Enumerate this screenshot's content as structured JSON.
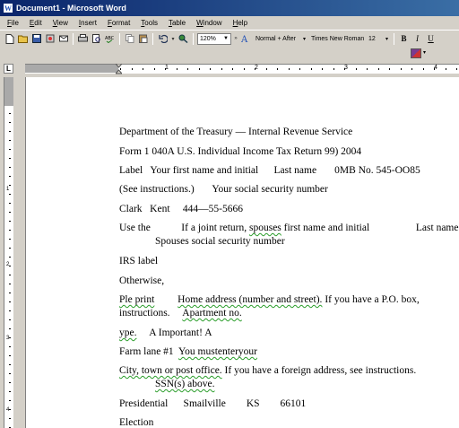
{
  "window": {
    "title": "Document1 - Microsoft Word"
  },
  "menu": [
    "File",
    "Edit",
    "View",
    "Insert",
    "Format",
    "Tools",
    "Table",
    "Window",
    "Help"
  ],
  "toolbar": {
    "zoom": "120%",
    "style": "Normal + After",
    "font": "Times New Roman",
    "size": "12",
    "bold": "B",
    "italic": "I",
    "underline": "U",
    "ruler_corner": "L"
  },
  "ruler": {
    "numbers": [
      "1",
      "2",
      "3",
      "4"
    ]
  },
  "vruler": {
    "numbers": [
      "1",
      "2",
      "3",
      "4"
    ]
  },
  "document": {
    "l1": "Department of the Treasury — Internal Revenue Service",
    "l2": "Form 1 040A U.S. Individual Income Tax Return 99) 2004",
    "l3a": "Label   Your first name and initial      Last name       0MB No. 545-OO85",
    "l4a": "(See instructions.)       Your social security number",
    "l5": "Clark   Kent     444—55-5666",
    "l6a": "Use the            If a joint return, ",
    "l6b": "spouses",
    "l6c": " first name and initial                  Last name",
    "l7": "Spouses social security number",
    "l8": "IRS label",
    "l9": "Otherwise,",
    "l10a": "Ple print",
    "l10b": "         ",
    "l10c": "Home address (number and street).",
    "l10d": " If you have a P.O. box,",
    "l11a": "instructions.",
    "l11b": "     ",
    "l11c": "Apartment no.",
    "l12a": "ype.",
    "l12b": "     A Important! A",
    "l13a": "Farm lane #1  ",
    "l13b": "You mustenteryour",
    "l14a": "City, town or post office.",
    "l14b": " If you have a foreign address, see instructions.",
    "l15": "SSN(s) above.",
    "l16": "Presidential      Smailville        KS        66101",
    "l17": "Election"
  }
}
